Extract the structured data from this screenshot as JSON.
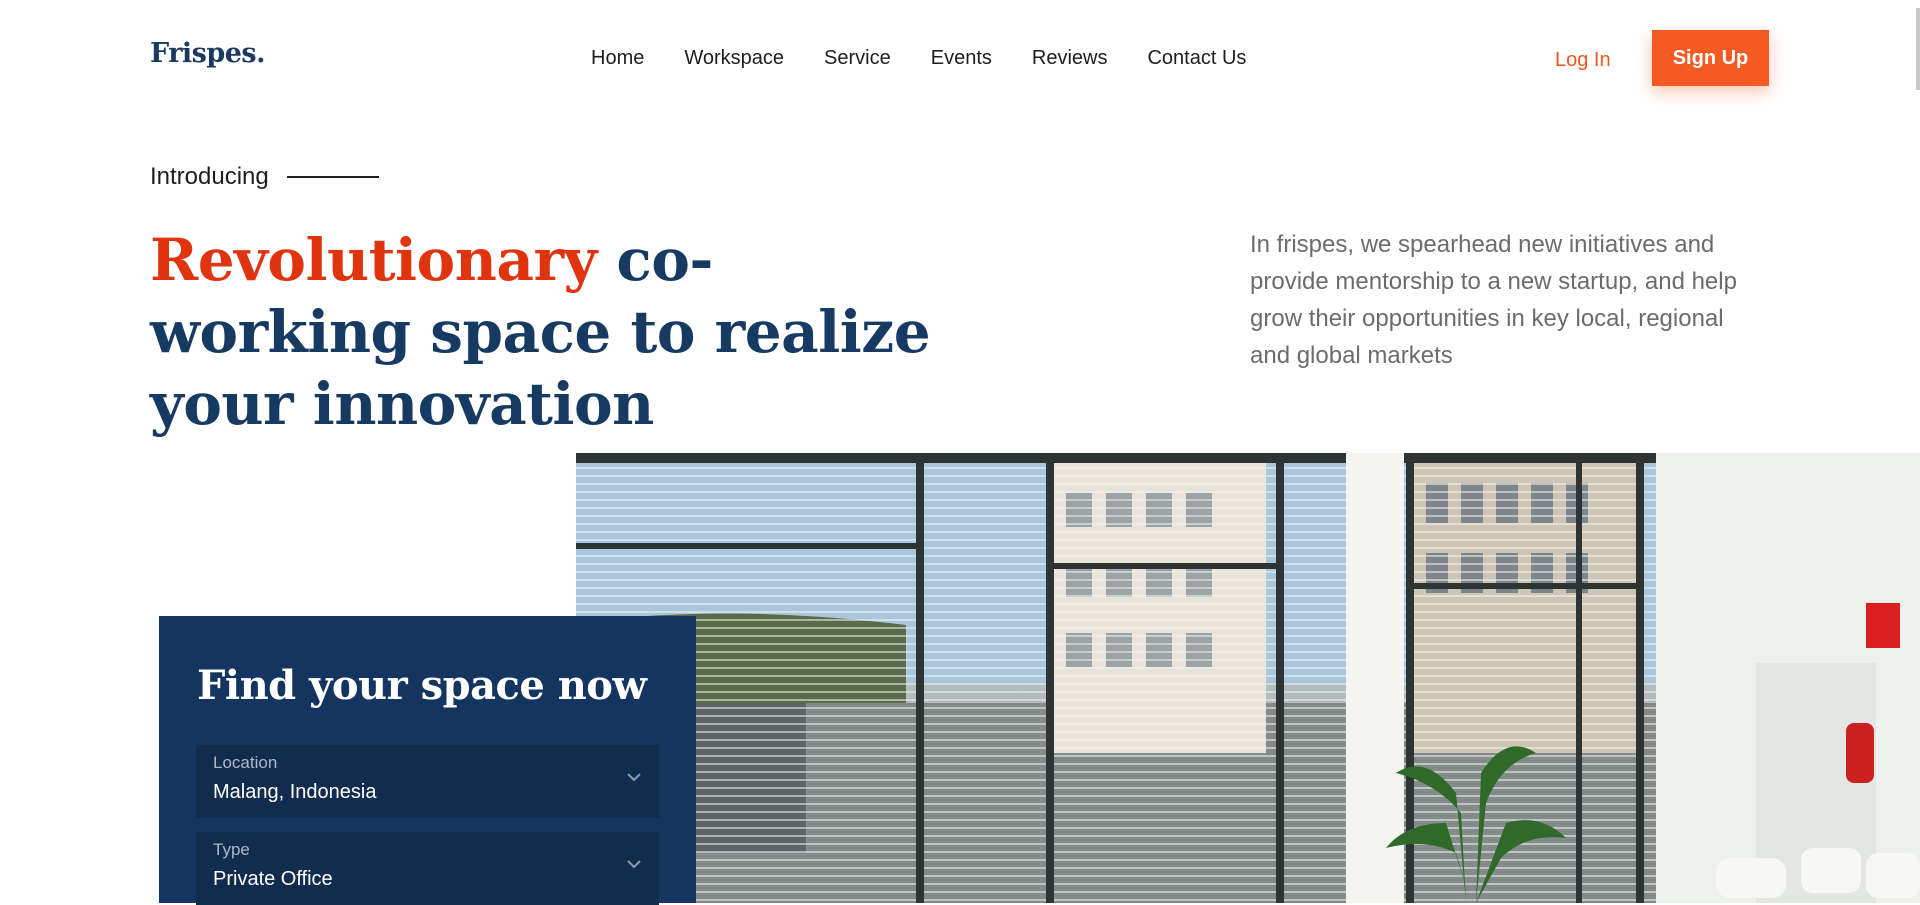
{
  "header": {
    "logo": "Frispes.",
    "nav": [
      "Home",
      "Workspace",
      "Service",
      "Events",
      "Reviews",
      "Contact Us"
    ],
    "login_label": "Log In",
    "signup_label": "Sign Up"
  },
  "hero": {
    "eyebrow": "Introducing",
    "headline_accent": "Revolutionary",
    "headline_rest": " co-working space to realize your innovation",
    "description": "In frispes, we spearhead new initiatives and provide mentorship to a new startup, and help grow their opportunities in key local, regional and global markets"
  },
  "finder": {
    "title": "Find your space now",
    "location": {
      "label": "Location",
      "value": "Malang, Indonesia"
    },
    "type": {
      "label": "Type",
      "value": "Private Office"
    }
  },
  "colors": {
    "navy": "#163a62",
    "accent_orange": "#f55a23",
    "headline_red": "#e0340f"
  }
}
